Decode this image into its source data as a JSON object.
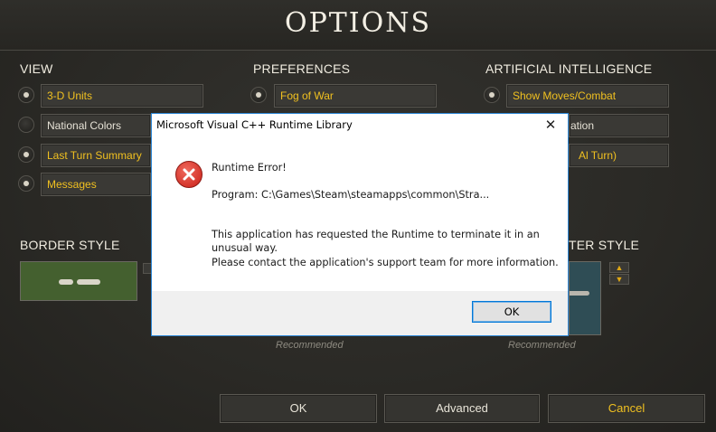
{
  "game": {
    "title": "OPTIONS",
    "sections": {
      "view": "VIEW",
      "preferences": "PREFERENCES",
      "ai": "ARTIFICIAL INTELLIGENCE",
      "border_style": "BORDER STYLE",
      "counter_style_partial": "TER STYLE"
    },
    "view_options": [
      "3-D Units",
      "National Colors",
      "Last Turn Summary",
      "Messages"
    ],
    "preference_options": [
      "Fog of War"
    ],
    "ai_options": [
      "Show Moves/Combat",
      "ation",
      "Al Turn)"
    ],
    "recommended": [
      "Recommended",
      "Recommended"
    ],
    "buttons": {
      "ok": "OK",
      "advanced": "Advanced",
      "cancel": "Cancel"
    },
    "colors": {
      "accent_yellow": "#f0c020",
      "panel": "#3a3935"
    }
  },
  "dialog": {
    "title": "Microsoft Visual C++ Runtime Library",
    "close_glyph": "✕",
    "heading": "Runtime Error!",
    "program": "Program: C:\\Games\\Steam\\steamapps\\common\\Stra...",
    "message_line1": "This application has requested the Runtime to terminate it in an",
    "message_line2": "unusual way.",
    "message_line3": "Please contact the application's support team for more information.",
    "ok": "OK",
    "icon": "error-icon"
  }
}
